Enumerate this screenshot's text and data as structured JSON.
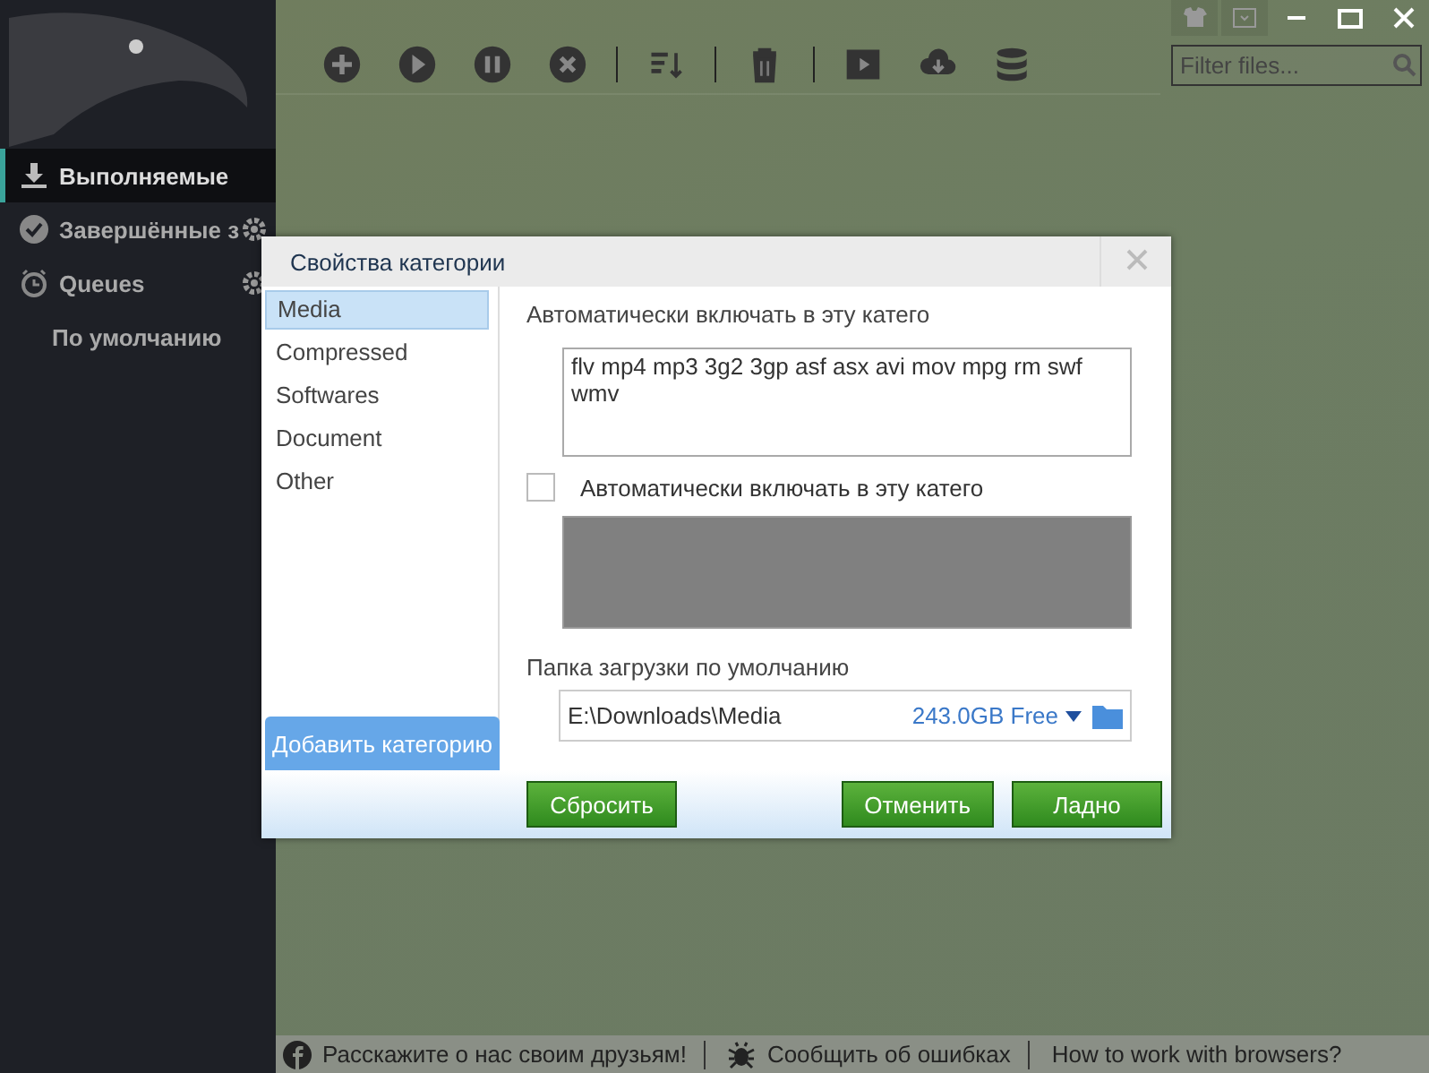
{
  "sidebar": {
    "items": [
      {
        "label": "Выполняемые",
        "kind": "downloading",
        "selected": true
      },
      {
        "label": "Завершённые з",
        "kind": "completed",
        "selected": false
      },
      {
        "label": "Queues",
        "kind": "queues",
        "selected": false,
        "children": [
          {
            "label": "По умолчанию",
            "selected": false
          }
        ]
      }
    ]
  },
  "toolbar": {
    "filter": {
      "placeholder": "Filter files..."
    }
  },
  "dialog": {
    "title": "Свойства категории",
    "categories": [
      {
        "label": "Media",
        "selected": true
      },
      {
        "label": "Compressed",
        "selected": false
      },
      {
        "label": "Softwares",
        "selected": false
      },
      {
        "label": "Document",
        "selected": false
      },
      {
        "label": "Other",
        "selected": false
      }
    ],
    "add_button": "Добавить категорию",
    "extensions_label": "Автоматически включать в эту катего",
    "extensions": "flv mp4 mp3 3g2 3gp asf asx avi mov mpg rm swf wmv",
    "sites": {
      "checked": false,
      "label": "Автоматически включать в эту катего",
      "disabled": true
    },
    "folder_label": "Папка загрузки по умолчанию",
    "folder": "E:\\Downloads\\Media",
    "free_space": "243.0GB Free",
    "buttons": [
      {
        "label": "Сбросить",
        "kind": "reset"
      },
      {
        "label": "Отменить",
        "kind": "cancel"
      },
      {
        "label": "Ладно",
        "kind": "ok"
      }
    ]
  },
  "status_bar": {
    "links": [
      {
        "label": "Расскажите о нас своим друзьям!",
        "kind": "facebook"
      },
      {
        "label": "Сообщить об ошибках",
        "kind": "bug"
      },
      {
        "label": "How to work with browsers?",
        "kind": "none"
      }
    ]
  }
}
